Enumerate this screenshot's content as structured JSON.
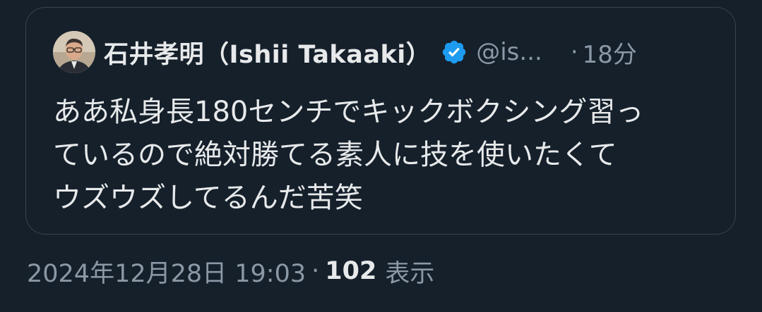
{
  "quoted_post": {
    "author": {
      "display_name": "石井孝明（Ishii Takaaki）",
      "handle": "@is...",
      "verified": true,
      "avatar": "profile-photo-man-with-glasses"
    },
    "separator": "·",
    "relative_time": "18分",
    "text": "ああ私身長180センチでキックボクシング習っ\nているので絶対勝てる素人に技を使いたくて\nウズウズしてるんだ苦笑"
  },
  "post_meta": {
    "timestamp": "2024年12月28日 19:03",
    "separator": "·",
    "view_count": "102",
    "view_label": "表示"
  },
  "colors": {
    "background": "#15202b",
    "border": "#38444d",
    "primary_text": "#e7e9ea",
    "secondary_text": "#8b98a5",
    "verified_badge": "#1d9bf0"
  },
  "icons": {
    "verified": "verified-badge-icon"
  }
}
